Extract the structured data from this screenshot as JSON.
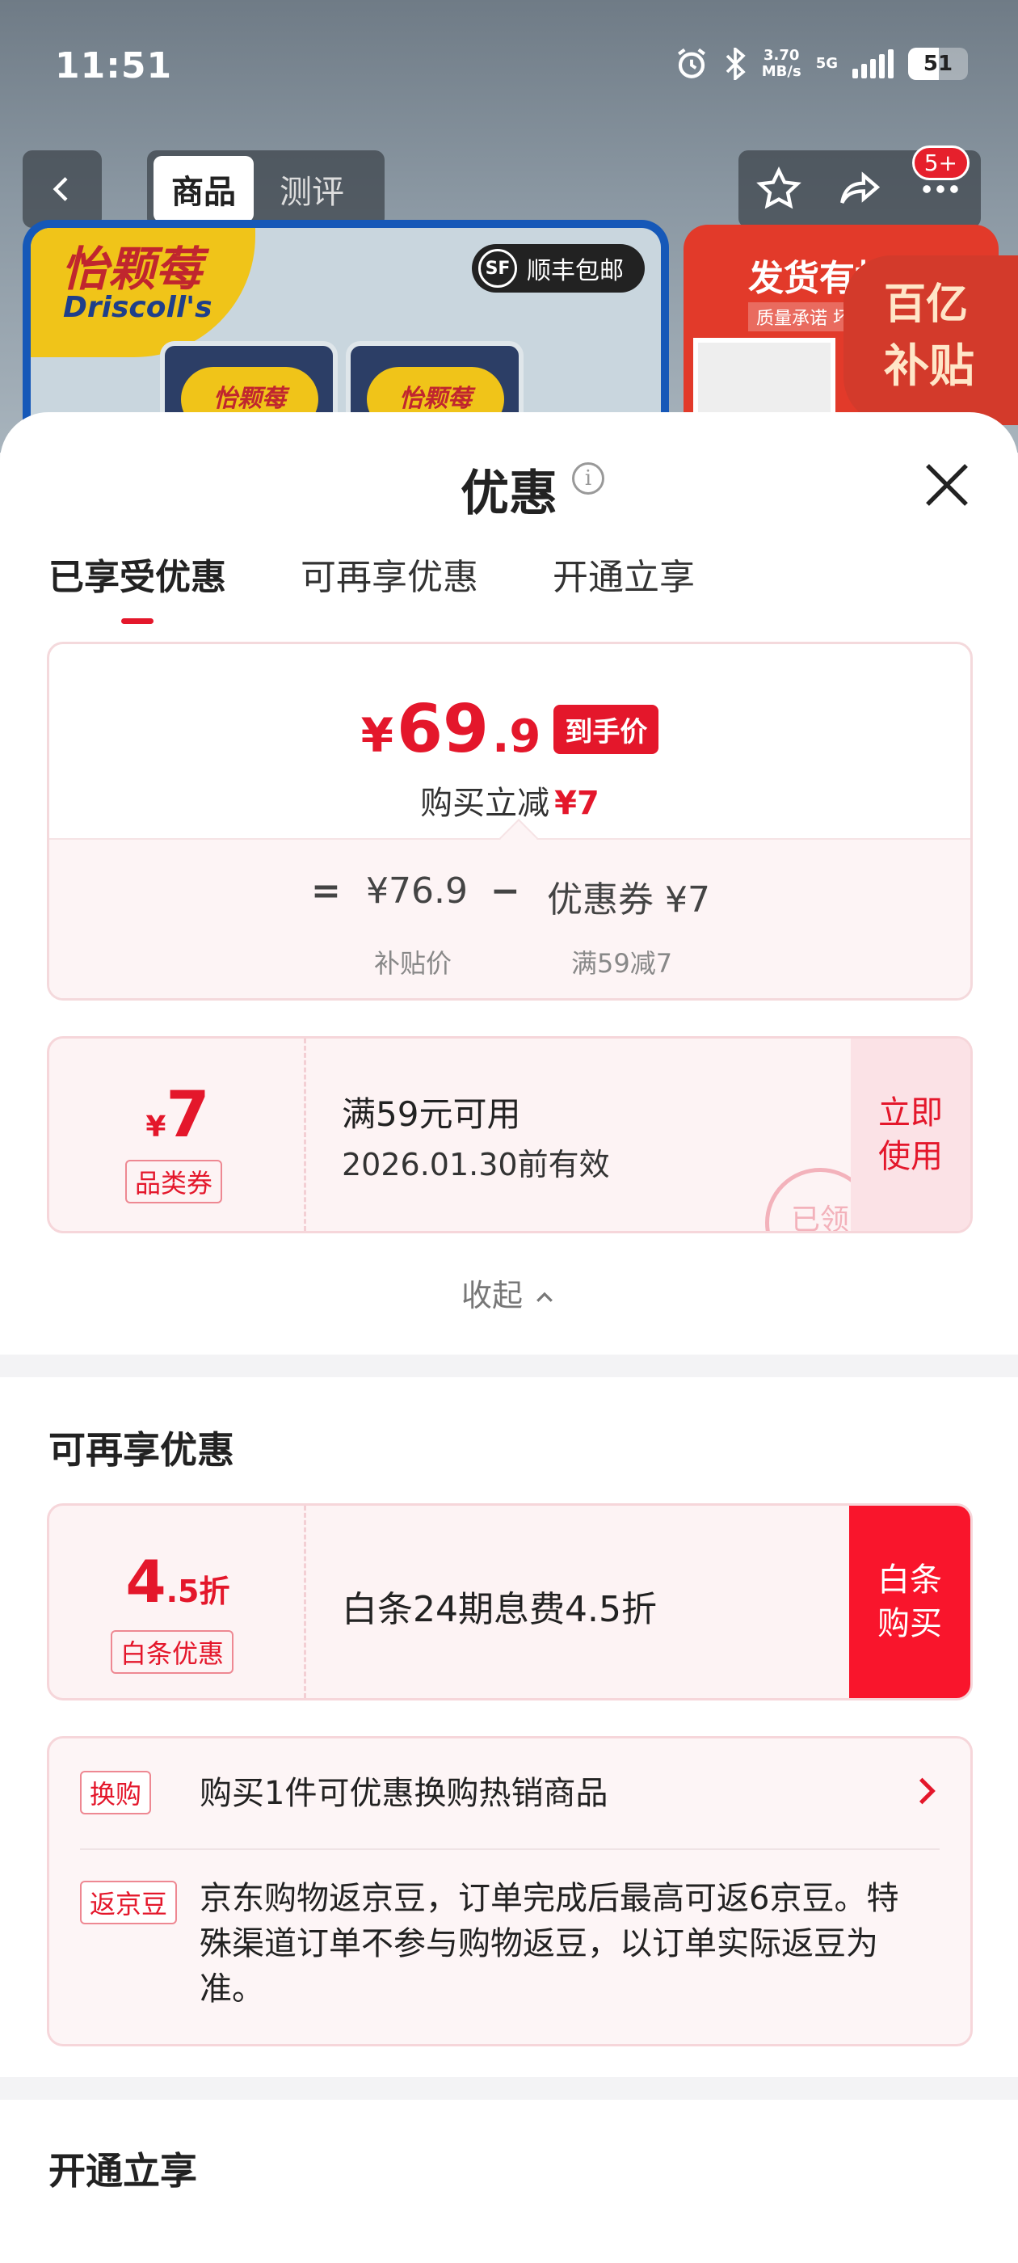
{
  "status_bar": {
    "time": "11:51",
    "speed": "3.70",
    "speed_unit": "MB/s",
    "network": "5G",
    "battery": "51",
    "battery_level": 0.51
  },
  "top_nav": {
    "tabs": [
      {
        "label": "商品",
        "active": true
      },
      {
        "label": "测评",
        "active": false
      }
    ],
    "badge": "5+"
  },
  "product": {
    "brand_cn": "怡颗莓",
    "brand_en": "Driscoll's",
    "shipping_badge": "顺丰包邮",
    "sf_logo": "SF",
    "box_label": "怡颗莓",
    "promo_title": "发货有标准",
    "promo_sub": "质量承诺 坏果",
    "subsidy_line1": "百亿",
    "subsidy_line2": "补贴"
  },
  "sheet": {
    "title": "优惠",
    "tabs": [
      {
        "label": "已享受优惠",
        "active": true
      },
      {
        "label": "可再享优惠",
        "active": false
      },
      {
        "label": "开通立享",
        "active": false
      }
    ]
  },
  "price_card": {
    "currency": "¥",
    "price_int": "69",
    "price_dec": ".9",
    "price_tag": "到手价",
    "reduce_label": "购买立减",
    "reduce_amount": "¥7",
    "equals": "=",
    "subsidy_price": "¥76.9",
    "minus": "−",
    "coupon_text": "优惠券 ¥7",
    "subsidy_price_label": "补贴价",
    "coupon_condition": "满59减7"
  },
  "coupon": {
    "currency": "¥",
    "amount": "7",
    "type_label": "品类券",
    "condition": "满59元可用",
    "expiry": "2026.01.30前有效",
    "action": "立即使用",
    "stamp": "已领"
  },
  "collapse_label": "收起",
  "more_section": {
    "title": "可再享优惠",
    "baitiao": {
      "discount_int": "4",
      "discount_dec": ".5折",
      "label": "白条优惠",
      "text": "白条24期息费4.5折",
      "action": "白条购买"
    },
    "exchange": {
      "tag": "换购",
      "text": "购买1件可优惠换购热销商品"
    },
    "jingdou": {
      "tag": "返京豆",
      "text": "京东购物返京豆，订单完成后最高可返6京豆。特殊渠道订单不参与购物返豆，以订单实际返豆为准。"
    }
  },
  "open_section": {
    "title": "开通立享"
  }
}
